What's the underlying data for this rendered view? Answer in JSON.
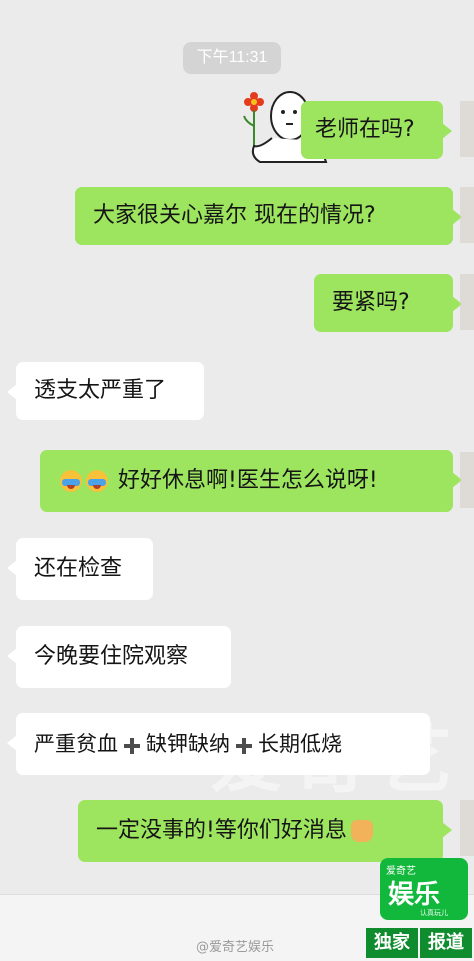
{
  "timestamp": "下午11:31",
  "messages": [
    {
      "side": "out",
      "text": "老师在吗?"
    },
    {
      "side": "out",
      "text": "大家很关心嘉尔 现在的情况?"
    },
    {
      "side": "out",
      "text": "要紧吗?"
    },
    {
      "side": "in",
      "text": "透支太严重了"
    },
    {
      "side": "out",
      "text": "好好休息啊!医生怎么说呀!"
    },
    {
      "side": "in",
      "text": "还在检查"
    },
    {
      "side": "in",
      "text": "今晚要住院观察"
    },
    {
      "side": "in",
      "parts": [
        "严重贫血",
        "缺钾缺纳",
        "长期低烧"
      ]
    },
    {
      "side": "out",
      "text": "一定没事的!等你们好消息"
    }
  ],
  "watermark": "爱奇艺",
  "weibo_handle": "@爱奇艺娱乐",
  "logo": {
    "top": "爱奇艺",
    "main": "娱乐",
    "sub": "认真玩儿",
    "tag_left": "独家",
    "tag_right": "报道"
  },
  "colors": {
    "outgoing": "#9de45f",
    "incoming": "#ffffff",
    "background": "#ebebeb",
    "brand_green": "#11b83c"
  }
}
